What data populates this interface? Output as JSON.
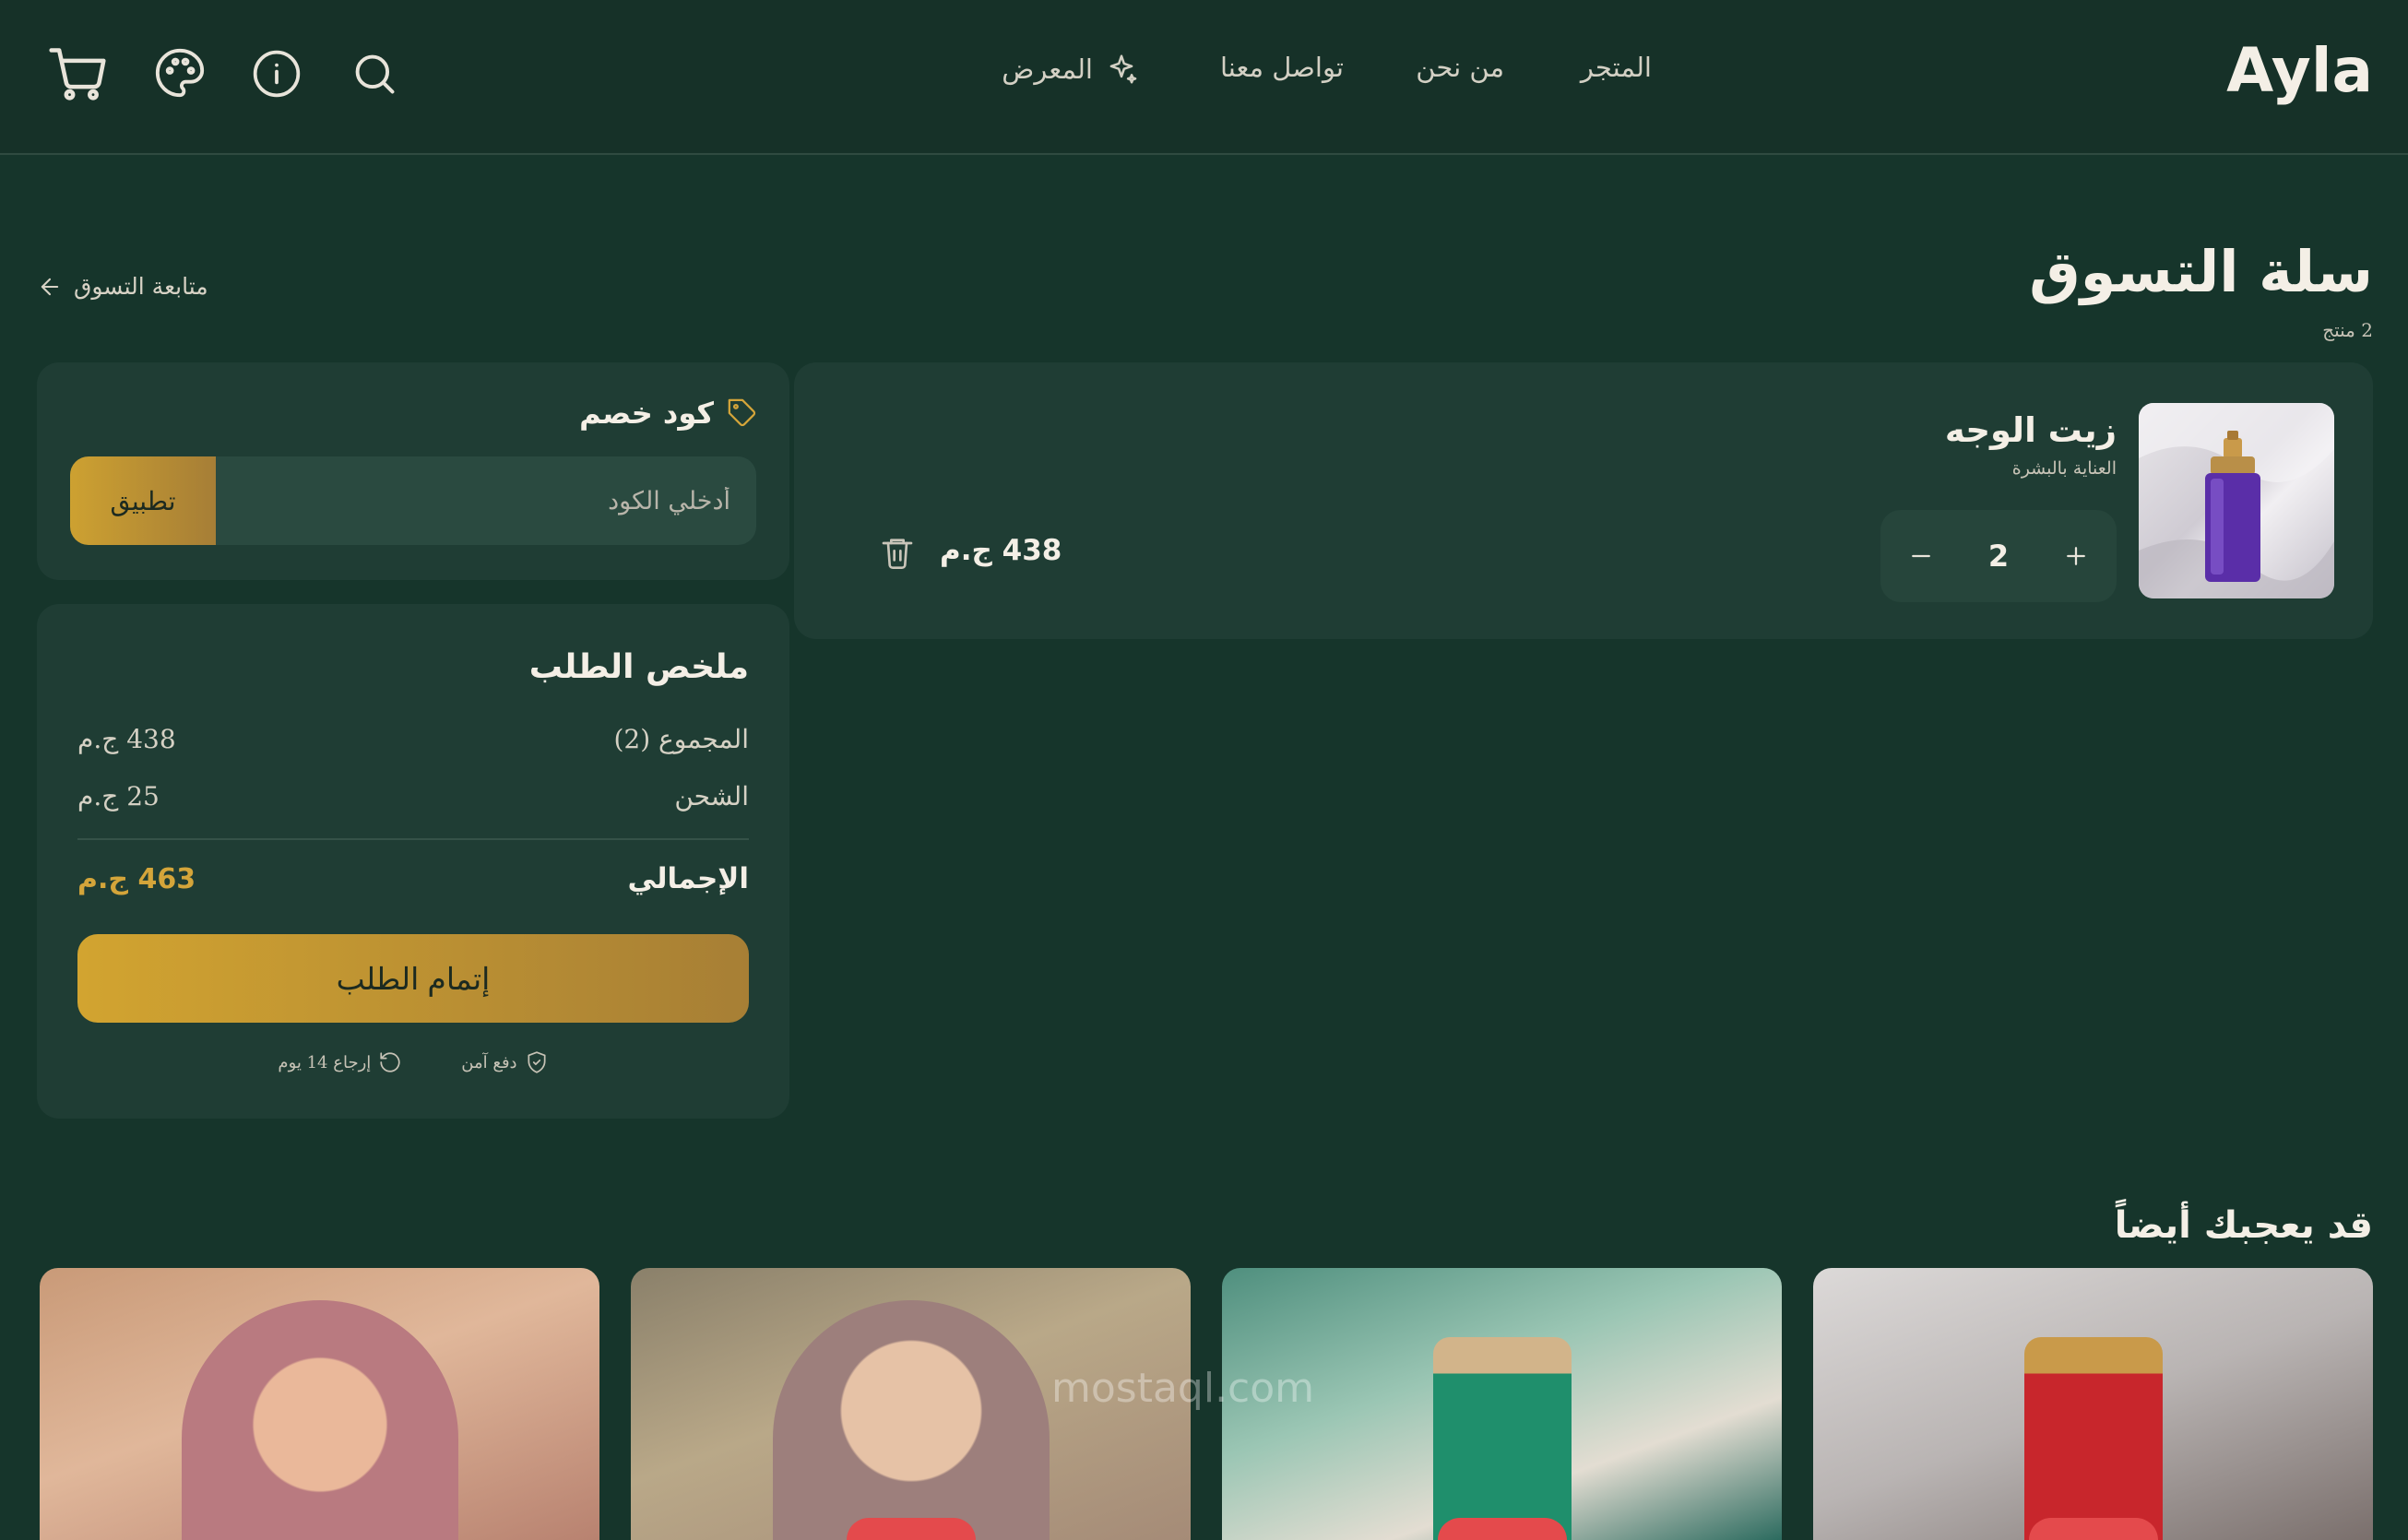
{
  "header": {
    "logo": "Ayla",
    "nav": {
      "shop": "المتجر",
      "about": "من نحن",
      "contact": "تواصل معنا",
      "gallery": "المعرض"
    }
  },
  "page": {
    "title": "سلة التسوق",
    "item_count": "2 منتج",
    "continue_shopping": "متابعة التسوق"
  },
  "cart": {
    "items": [
      {
        "name": "زيت الوجه",
        "category": "العناية بالبشرة",
        "quantity": "2",
        "line_price": "438 ج.م",
        "image_icon": "perfume-bottle-image"
      }
    ]
  },
  "coupon": {
    "title": "كود خصم",
    "placeholder": "أدخلي الكود",
    "apply_label": "تطبيق"
  },
  "summary": {
    "title": "ملخص الطلب",
    "subtotal_label": "المجموع (2)",
    "subtotal_value": "438 ج.م",
    "shipping_label": "الشحن",
    "shipping_value": "25 ج.م",
    "total_label": "الإجمالي",
    "total_value": "463 ج.م",
    "checkout_label": "إتمام الطلب",
    "trust_secure": "دفع آمن",
    "trust_returns": "إرجاع 14 يوم"
  },
  "recommendations": {
    "title": "قد يعجبك أيضاً"
  },
  "watermark": "mostaql.com",
  "colors": {
    "background": "#16352b",
    "card": "#1f3d34",
    "accent_gold": "#d4a53a",
    "badge_red": "#e44a4c"
  }
}
